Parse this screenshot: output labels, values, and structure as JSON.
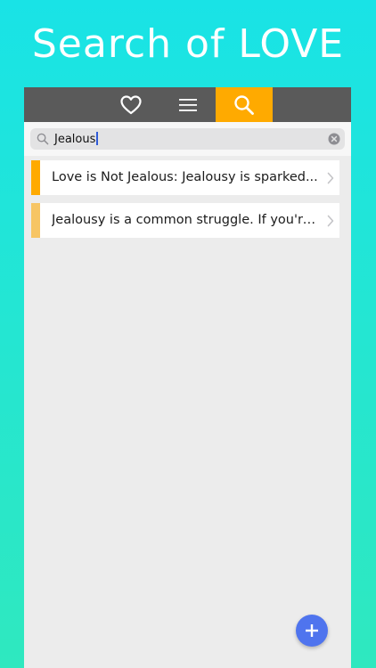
{
  "promo": {
    "title": "Search of LOVE"
  },
  "tabbar": {
    "tabs": [
      {
        "icon": "heart-icon",
        "active": false
      },
      {
        "icon": "menu-icon",
        "active": false
      },
      {
        "icon": "search-icon",
        "active": true
      }
    ]
  },
  "search": {
    "value": "Jealous",
    "placeholder": ""
  },
  "results": [
    {
      "text": "Love is Not Jealous: Jealousy is sparked by insecurity",
      "display": "Love is Not Jealous: Jealousy is sparked...",
      "accent": "#ffaa00"
    },
    {
      "text": "Jealousy is a common struggle. If you're not careful",
      "display": "Jealousy is a common struggle. If you're n...",
      "accent": "#f7c564"
    }
  ],
  "fab": {
    "icon": "plus-icon"
  },
  "colors": {
    "accent": "#ffaa00",
    "tabbar": "#5a5a5a",
    "fab": "#4f74ee",
    "background_top": "#19e3e6",
    "background_bottom": "#2fe8bf"
  }
}
